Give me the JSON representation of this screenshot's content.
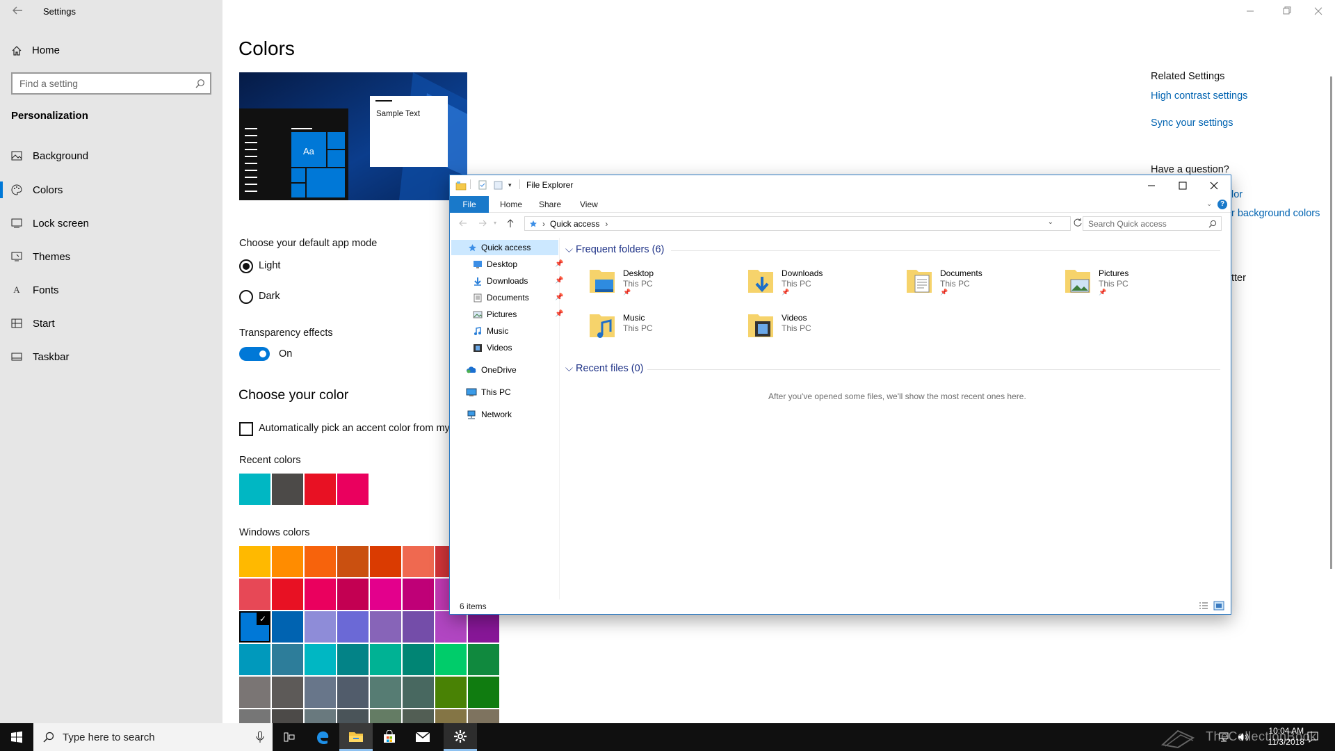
{
  "settings": {
    "app_title": "Settings",
    "home_label": "Home",
    "search_placeholder": "Find a setting",
    "section_title": "Personalization",
    "nav": [
      {
        "label": "Background",
        "icon": "picture-icon"
      },
      {
        "label": "Colors",
        "icon": "palette-icon",
        "selected": true
      },
      {
        "label": "Lock screen",
        "icon": "lock-screen-icon"
      },
      {
        "label": "Themes",
        "icon": "brush-icon"
      },
      {
        "label": "Fonts",
        "icon": "font-icon"
      },
      {
        "label": "Start",
        "icon": "start-icon"
      },
      {
        "label": "Taskbar",
        "icon": "taskbar-icon"
      }
    ],
    "page_title": "Colors",
    "preview_sample_text": "Sample Text",
    "preview_tile_text": "Aa",
    "app_mode_heading": "Choose your default app mode",
    "app_mode_options": [
      {
        "label": "Light",
        "selected": true
      },
      {
        "label": "Dark",
        "selected": false
      }
    ],
    "transparency_heading": "Transparency effects",
    "transparency_state": "On",
    "transparency_on": true,
    "choose_color_heading": "Choose your color",
    "auto_pick_label": "Automatically pick an accent color from my b",
    "recent_colors_heading": "Recent colors",
    "recent_colors": [
      "#00b7c3",
      "#4c4a48",
      "#e81123",
      "#ea005e"
    ],
    "windows_colors_heading": "Windows colors",
    "windows_colors": [
      [
        "#ffb900",
        "#ff8c00",
        "#f7630c",
        "#ca5010",
        "#da3b01",
        "#ef6950",
        "#d13438",
        ""
      ],
      [
        "#e74856",
        "#e81123",
        "#ea005e",
        "#c30052",
        "#e3008c",
        "#bf0077",
        "#c239b3",
        ""
      ],
      [
        "#0078d7",
        "#0063b1",
        "#8e8cd8",
        "#6b69d6",
        "#8764b8",
        "#744da9",
        "#b146c2",
        "#881798"
      ],
      [
        "#0099bc",
        "#2d7d9a",
        "#00b7c3",
        "#038387",
        "#00b294",
        "#018574",
        "#00cc6a",
        "#10893e"
      ],
      [
        "#7a7574",
        "#5d5a58",
        "#68768a",
        "#515c6b",
        "#567c73",
        "#486860",
        "#498205",
        "#107c10"
      ],
      [
        "#767676",
        "#4c4a48",
        "#69797e",
        "#4a5459",
        "#647c64",
        "#525e54",
        "#847545",
        "#7e735f"
      ]
    ],
    "selected_color": "#0078d7",
    "related_heading": "Related Settings",
    "related_links": [
      "High contrast settings",
      "Sync your settings"
    ],
    "question_heading": "Have a question?",
    "partial_link_1": "lor",
    "partial_link_2": "r background colors",
    "partial_text_3": "tter"
  },
  "explorer": {
    "title": "File Explorer",
    "ribbon_tabs": [
      "File",
      "Home",
      "Share",
      "View"
    ],
    "address_path": "Quick access",
    "search_placeholder": "Search Quick access",
    "nav_items": [
      {
        "label": "Quick access",
        "icon": "star-icon",
        "pinned": false,
        "selected": true
      },
      {
        "label": "Desktop",
        "icon": "desktop-folder-icon",
        "pinned": true
      },
      {
        "label": "Downloads",
        "icon": "downloads-folder-icon",
        "pinned": true
      },
      {
        "label": "Documents",
        "icon": "documents-folder-icon",
        "pinned": true
      },
      {
        "label": "Pictures",
        "icon": "pictures-folder-icon",
        "pinned": true
      },
      {
        "label": "Music",
        "icon": "music-folder-icon",
        "pinned": false
      },
      {
        "label": "Videos",
        "icon": "videos-folder-icon",
        "pinned": false
      },
      {
        "label": "OneDrive",
        "icon": "onedrive-icon",
        "pinned": false
      },
      {
        "label": "This PC",
        "icon": "this-pc-icon",
        "pinned": false
      },
      {
        "label": "Network",
        "icon": "network-icon",
        "pinned": false
      }
    ],
    "frequent_heading": "Frequent folders (6)",
    "folders": [
      {
        "name": "Desktop",
        "location": "This PC",
        "pinned": true
      },
      {
        "name": "Downloads",
        "location": "This PC",
        "pinned": true
      },
      {
        "name": "Documents",
        "location": "This PC",
        "pinned": true
      },
      {
        "name": "Pictures",
        "location": "This PC",
        "pinned": true
      },
      {
        "name": "Music",
        "location": "This PC",
        "pinned": false
      },
      {
        "name": "Videos",
        "location": "This PC",
        "pinned": false
      }
    ],
    "recent_heading": "Recent files (0)",
    "recent_empty": "After you've opened some files, we'll show the most recent ones here.",
    "status_items": "6 items"
  },
  "taskbar": {
    "search_placeholder": "Type here to search",
    "time": "10:04 AM",
    "date": "11/3/2018",
    "watermark": "TheCollectionBook"
  }
}
